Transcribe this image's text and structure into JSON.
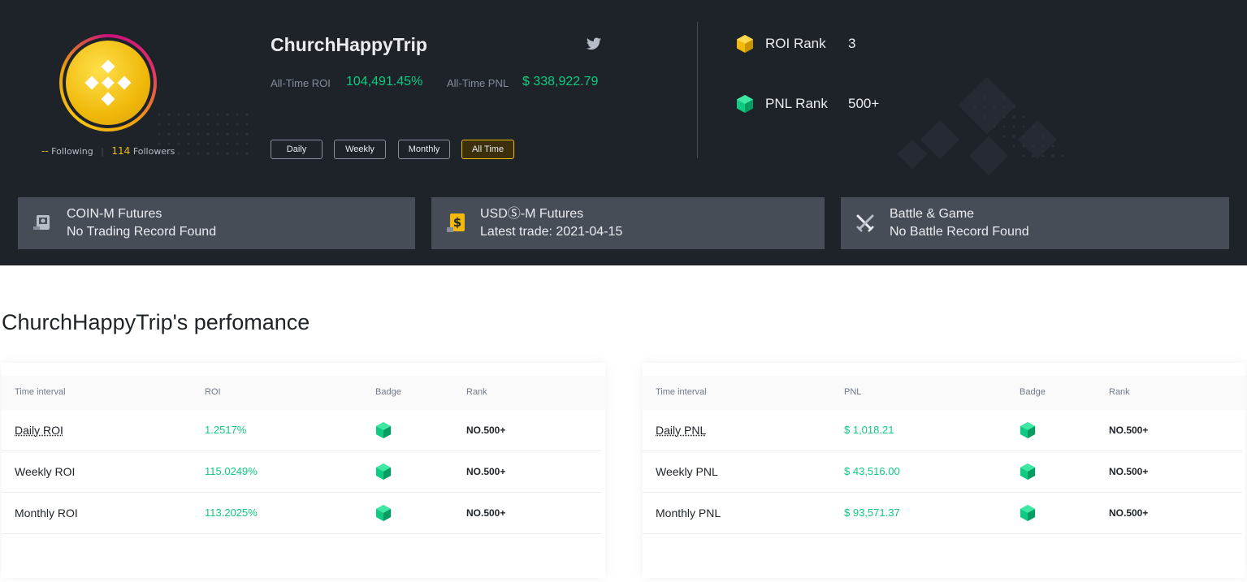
{
  "profile": {
    "username": "ChurchHappyTrip",
    "following_count": "--",
    "following_label": "Following",
    "followers_count": "114",
    "followers_label": "Followers",
    "all_time_roi_label": "All-Time ROI",
    "all_time_roi_value": "104,491.45%",
    "all_time_pnl_label": "All-Time PNL",
    "all_time_pnl_value": "$ 338,922.79"
  },
  "periods": [
    "Daily",
    "Weekly",
    "Monthly",
    "All Time"
  ],
  "active_period": "All Time",
  "ranks": [
    {
      "label": "ROI Rank",
      "value": "3",
      "badge_color": "#f0b90b"
    },
    {
      "label": "PNL Rank",
      "value": "500+",
      "badge_color": "#0ecb81"
    }
  ],
  "cards": [
    {
      "title": "COIN-M Futures",
      "subtitle": "No Trading Record Found",
      "icon": "coin-m-futures-icon"
    },
    {
      "title": "USDⓈ-M Futures",
      "subtitle": "Latest trade: 2021-04-15",
      "icon": "usds-m-futures-icon"
    },
    {
      "title": "Battle & Game",
      "subtitle": "No Battle Record Found",
      "icon": "crossed-swords-icon"
    }
  ],
  "performance_title": "ChurchHappyTrip's perfomance",
  "roi_table": {
    "headers": [
      "Time interval",
      "ROI",
      "Badge",
      "Rank"
    ],
    "rows": [
      {
        "interval": "Daily ROI",
        "value": "1.2517%",
        "rank": "NO.500+"
      },
      {
        "interval": "Weekly ROI",
        "value": "115.0249%",
        "rank": "NO.500+"
      },
      {
        "interval": "Monthly ROI",
        "value": "113.2025%",
        "rank": "NO.500+"
      }
    ]
  },
  "pnl_table": {
    "headers": [
      "Time interval",
      "PNL",
      "Badge",
      "Rank"
    ],
    "rows": [
      {
        "interval": "Daily PNL",
        "value": "$ 1,018.21",
        "rank": "NO.500+"
      },
      {
        "interval": "Weekly PNL",
        "value": "$ 43,516.00",
        "rank": "NO.500+"
      },
      {
        "interval": "Monthly PNL",
        "value": "$ 93,571.37",
        "rank": "NO.500+"
      }
    ]
  },
  "colors": {
    "accent": "#f0b90b",
    "positive": "#0ecb81",
    "hero_bg": "#1e2329",
    "card_bg": "#474d57"
  }
}
